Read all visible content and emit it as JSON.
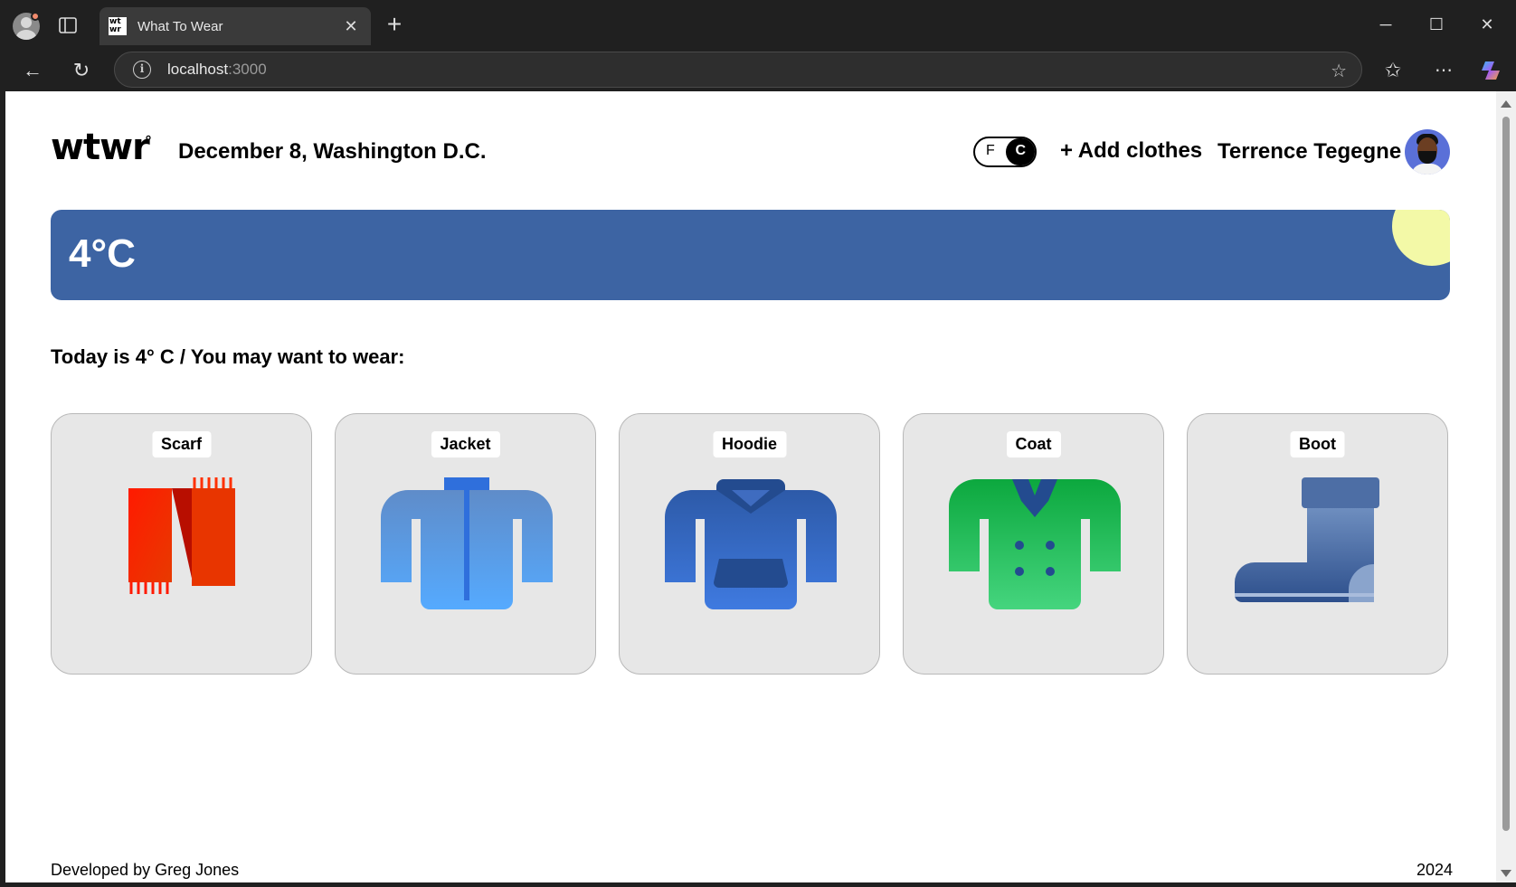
{
  "browser": {
    "tab_title": "What To Wear",
    "favicon_text": "wt wr",
    "url_host": "localhost",
    "url_port": ":3000"
  },
  "header": {
    "logo": "wtwr",
    "logo_degree": "°",
    "date_location": "December 8, Washington D.C.",
    "toggle_f": "F",
    "toggle_c": "C",
    "add_clothes": "+ Add clothes",
    "username": "Terrence Tegegne"
  },
  "weather": {
    "temperature": "4°C",
    "colors": {
      "card": "#3d64a3",
      "sun": "#f3f9a7"
    }
  },
  "main": {
    "subtitle": "Today is 4° C / You may want to wear:",
    "items": [
      {
        "name": "Scarf",
        "icon": "scarf-icon"
      },
      {
        "name": "Jacket",
        "icon": "jacket-icon"
      },
      {
        "name": "Hoodie",
        "icon": "hoodie-icon"
      },
      {
        "name": "Coat",
        "icon": "coat-icon"
      },
      {
        "name": "Boot",
        "icon": "boot-icon"
      }
    ]
  },
  "footer": {
    "developer": "Developed by Greg Jones",
    "year": "2024"
  }
}
